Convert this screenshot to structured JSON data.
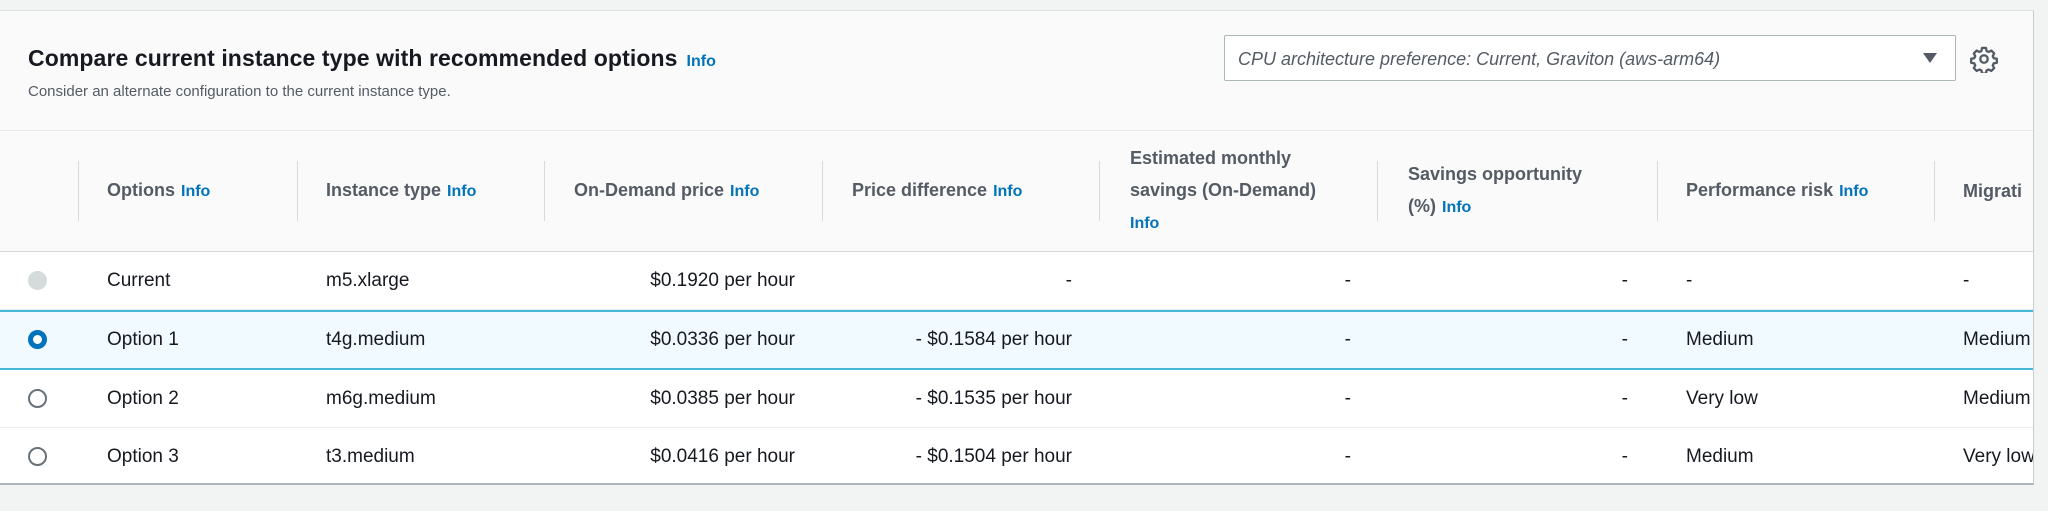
{
  "header": {
    "title": "Compare current instance type with recommended options",
    "title_info": "Info",
    "description": "Consider an alternate configuration to the current instance type.",
    "cpu_select": {
      "value": "CPU architecture preference: Current, Graviton (aws-arm64)"
    },
    "settings_icon": "gear-icon"
  },
  "table": {
    "columns": [
      {
        "label": "Options",
        "info": "Info"
      },
      {
        "label": "Instance type",
        "info": "Info"
      },
      {
        "label": "On-Demand price",
        "info": "Info"
      },
      {
        "label": "Price difference",
        "info": "Info"
      },
      {
        "label": "Estimated monthly savings (On-Demand)",
        "info": "Info"
      },
      {
        "label": "Savings opportunity (%)",
        "info": "Info"
      },
      {
        "label": "Performance risk",
        "info": "Info"
      },
      {
        "label": "Migrati",
        "info": ""
      }
    ],
    "rows": [
      {
        "option": "Current",
        "instance_type": "m5.xlarge",
        "on_demand_price": "$0.1920 per hour",
        "price_difference": "-",
        "est_monthly_savings": "-",
        "savings_opportunity": "-",
        "performance_risk": "-",
        "migration": "-",
        "radio": "disabled"
      },
      {
        "option": "Option 1",
        "instance_type": "t4g.medium",
        "on_demand_price": "$0.0336 per hour",
        "price_difference": "- $0.1584 per hour",
        "est_monthly_savings": "-",
        "savings_opportunity": "-",
        "performance_risk": "Medium",
        "migration": "Medium",
        "radio": "checked"
      },
      {
        "option": "Option 2",
        "instance_type": "m6g.medium",
        "on_demand_price": "$0.0385 per hour",
        "price_difference": "- $0.1535 per hour",
        "est_monthly_savings": "-",
        "savings_opportunity": "-",
        "performance_risk": "Very low",
        "migration": "Medium",
        "radio": "unchecked"
      },
      {
        "option": "Option 3",
        "instance_type": "t3.medium",
        "on_demand_price": "$0.0416 per hour",
        "price_difference": "- $0.1504 per hour",
        "est_monthly_savings": "-",
        "savings_opportunity": "-",
        "performance_risk": "Medium",
        "migration": "Very low",
        "radio": "unchecked"
      }
    ]
  },
  "colors": {
    "link": "#0073bb",
    "selected_row_bg": "#f1faff",
    "selected_row_border": "#44b9d6"
  }
}
